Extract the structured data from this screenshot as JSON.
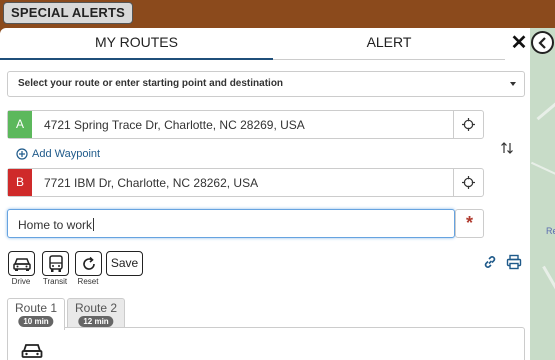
{
  "header": {
    "special_alerts": "SPECIAL ALERTS"
  },
  "tabs": {
    "my_routes": "MY ROUTES",
    "alert": "ALERT"
  },
  "route_select": {
    "placeholder": "Select your route or enter starting point and destination"
  },
  "start": {
    "badge": "A",
    "address": "4721 Spring Trace Dr, Charlotte, NC 28269, USA",
    "badge_color": "#5cb85c"
  },
  "add_waypoint": {
    "label": "Add Waypoint"
  },
  "destination": {
    "badge": "B",
    "address": "7721 IBM Dr, Charlotte, NC 28262, USA",
    "badge_color": "#cf2a2a"
  },
  "route_name": {
    "value": "Home to work"
  },
  "modes": [
    {
      "label": "Drive",
      "icon": "car-icon"
    },
    {
      "label": "Transit",
      "icon": "bus-icon"
    },
    {
      "label": "Reset",
      "icon": "reset-icon"
    }
  ],
  "save_label": "Save",
  "route_tabs": [
    {
      "name": "Route 1",
      "time": "10 min"
    },
    {
      "name": "Route 2",
      "time": "12 min"
    }
  ],
  "map": {
    "label_fragment": "Re"
  },
  "colors": {
    "header_bg": "#8b4a1c",
    "accent": "#1f5a8a"
  }
}
